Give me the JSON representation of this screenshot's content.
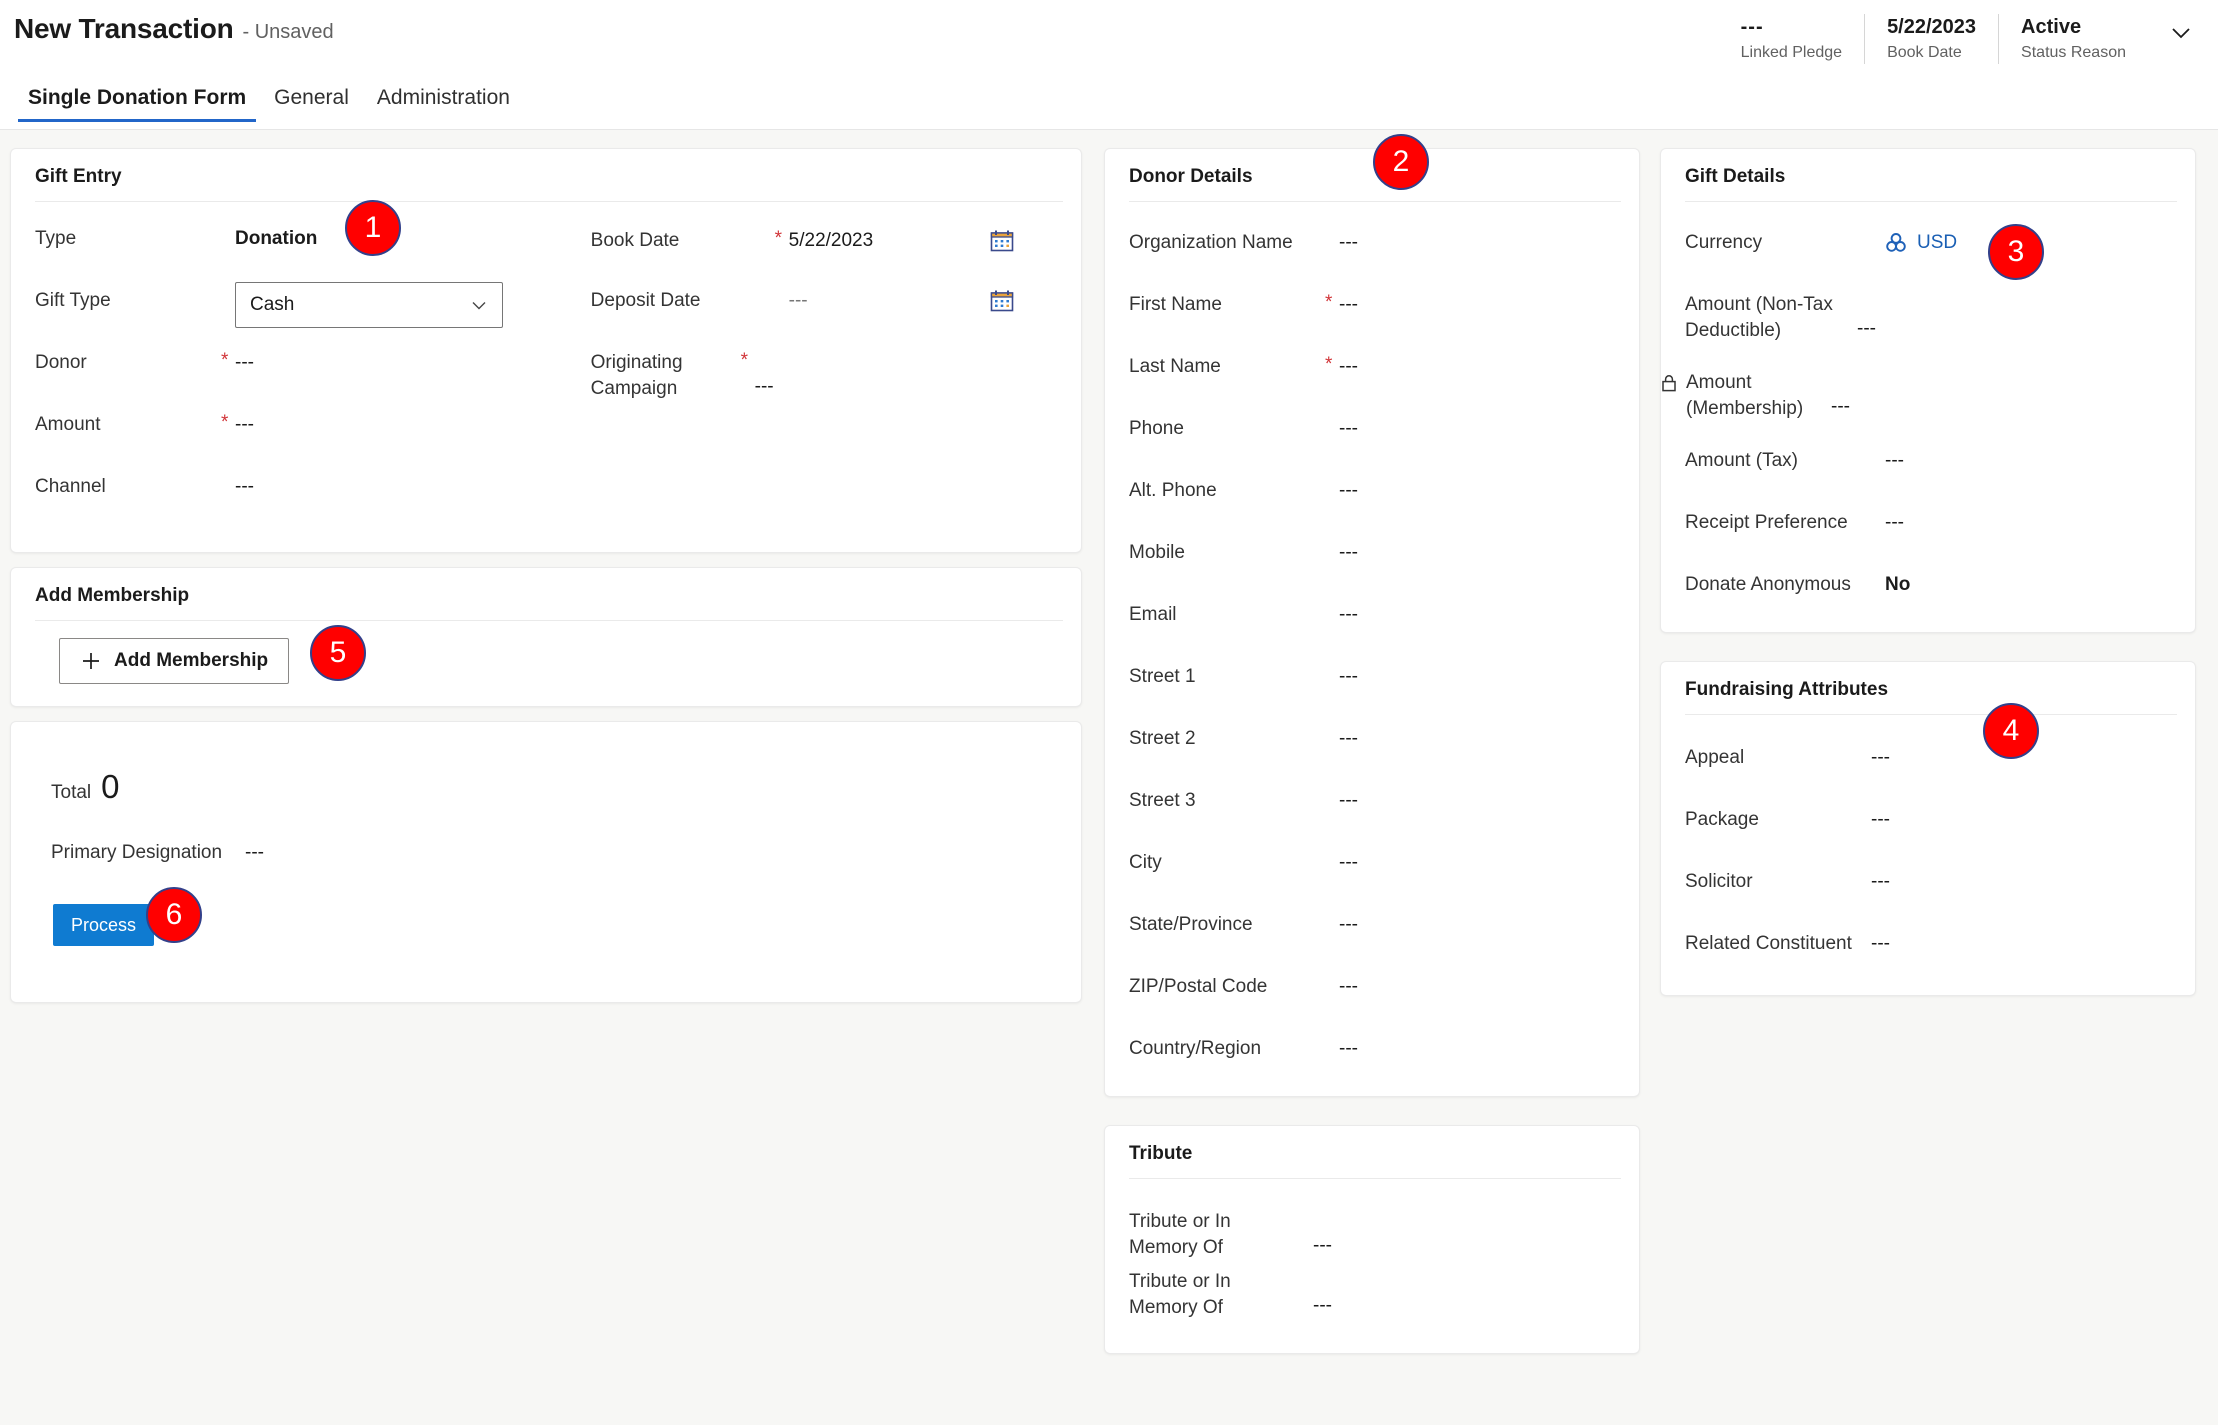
{
  "header": {
    "title": "New Transaction",
    "subtitle": "- Unsaved",
    "stats": [
      {
        "value": "---",
        "label": "Linked Pledge"
      },
      {
        "value": "5/22/2023",
        "label": "Book Date"
      },
      {
        "value": "Active",
        "label": "Status Reason"
      }
    ],
    "chevron_icon": "chevron-down-icon"
  },
  "tabs": [
    {
      "label": "Single Donation Form",
      "active": true
    },
    {
      "label": "General",
      "active": false
    },
    {
      "label": "Administration",
      "active": false
    }
  ],
  "gift_entry": {
    "title": "Gift Entry",
    "left_fields": [
      {
        "label": "Type",
        "value": "Donation",
        "required": false,
        "bold": true
      },
      {
        "label": "Gift Type",
        "value": "Cash",
        "required": false,
        "control": "select"
      },
      {
        "label": "Donor",
        "value": "---",
        "required": true
      },
      {
        "label": "Amount",
        "value": "---",
        "required": true
      },
      {
        "label": "Channel",
        "value": "---",
        "required": false
      }
    ],
    "right_fields": [
      {
        "label": "Book Date",
        "value": "5/22/2023",
        "required": true,
        "icon": "calendar-icon"
      },
      {
        "label": "Deposit Date",
        "value": "---",
        "required": false,
        "icon": "calendar-icon"
      },
      {
        "label": "Originating Campaign",
        "value": "---",
        "required": true,
        "icon": ""
      }
    ]
  },
  "add_membership": {
    "title": "Add Membership",
    "button_label": "Add Membership",
    "button_icon": "plus-icon"
  },
  "totals": {
    "total_label": "Total",
    "total_value": "0",
    "primary_designation_label": "Primary Designation",
    "primary_designation_value": "---",
    "process_label": "Process"
  },
  "donor_details": {
    "title": "Donor Details",
    "fields": [
      {
        "label": "Organization Name",
        "value": "---",
        "required": false
      },
      {
        "label": "First Name",
        "value": "---",
        "required": true
      },
      {
        "label": "Last Name",
        "value": "---",
        "required": true
      },
      {
        "label": "Phone",
        "value": "---",
        "required": false
      },
      {
        "label": "Alt. Phone",
        "value": "---",
        "required": false
      },
      {
        "label": "Mobile",
        "value": "---",
        "required": false
      },
      {
        "label": "Email",
        "value": "---",
        "required": false
      },
      {
        "label": "Street 1",
        "value": "---",
        "required": false
      },
      {
        "label": "Street 2",
        "value": "---",
        "required": false
      },
      {
        "label": "Street 3",
        "value": "---",
        "required": false
      },
      {
        "label": "City",
        "value": "---",
        "required": false
      },
      {
        "label": "State/Province",
        "value": "---",
        "required": false
      },
      {
        "label": "ZIP/Postal Code",
        "value": "---",
        "required": false
      },
      {
        "label": "Country/Region",
        "value": "---",
        "required": false
      }
    ]
  },
  "tribute": {
    "title": "Tribute",
    "fields": [
      {
        "label": "Tribute or In Memory Of",
        "value": "---",
        "required": false
      },
      {
        "label": "Tribute or In Memory Of",
        "value": "---",
        "required": false
      }
    ]
  },
  "gift_details": {
    "title": "Gift Details",
    "fields": [
      {
        "label": "Currency",
        "value": "USD",
        "required": false,
        "value_icon": "currency-icon",
        "link": true
      },
      {
        "label": "Amount (Non-Tax Deductible)",
        "value": "---",
        "required": false
      },
      {
        "label": "Amount (Membership)",
        "value": "---",
        "required": false,
        "label_icon": "lock-icon"
      },
      {
        "label": "Amount (Tax)",
        "value": "---",
        "required": false
      },
      {
        "label": "Receipt Preference",
        "value": "---",
        "required": false
      },
      {
        "label": "Donate Anonymous",
        "value": "No",
        "required": false,
        "bold": true
      }
    ]
  },
  "fundraising_attributes": {
    "title": "Fundraising Attributes",
    "fields": [
      {
        "label": "Appeal",
        "value": "---",
        "required": false
      },
      {
        "label": "Package",
        "value": "---",
        "required": false
      },
      {
        "label": "Solicitor",
        "value": "---",
        "required": false
      },
      {
        "label": "Related Constituent",
        "value": "---",
        "required": false
      }
    ]
  },
  "annotations": [
    {
      "number": "1"
    },
    {
      "number": "2"
    },
    {
      "number": "3"
    },
    {
      "number": "4"
    },
    {
      "number": "5"
    },
    {
      "number": "6"
    }
  ],
  "colors": {
    "accent_blue": "#2266c9",
    "primary_button": "#0f7bd1",
    "required_red": "#d13438",
    "annotation_red": "#ff0000",
    "link_blue": "#1a5fb4"
  }
}
